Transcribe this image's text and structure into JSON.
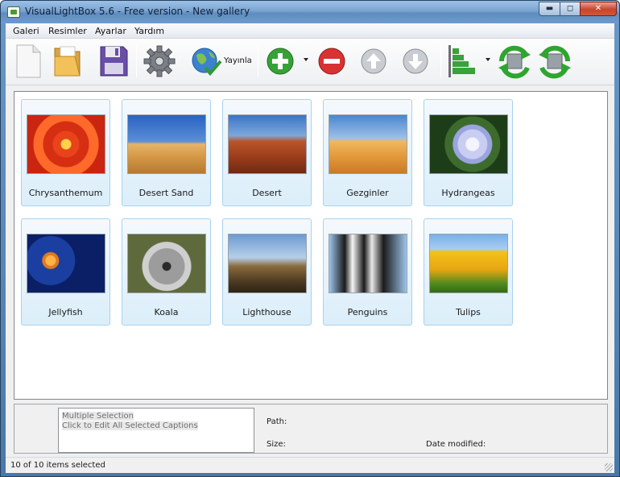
{
  "window": {
    "title": "VisualLightBox 5.6 - Free version -  New gallery"
  },
  "menu": [
    "Galeri",
    "Resimler",
    "Ayarlar",
    "Yardım"
  ],
  "toolbar": {
    "publish_label": "Yayınla",
    "icons": [
      "new-file-icon",
      "open-folder-icon",
      "save-disk-icon",
      "settings-gear-icon",
      "publish-globe-icon",
      "add-icon",
      "remove-icon",
      "move-up-icon",
      "move-down-icon",
      "sort-icon",
      "rotate-left-icon",
      "rotate-right-icon"
    ]
  },
  "gallery": {
    "items": [
      {
        "caption": "Chrysanthemum"
      },
      {
        "caption": "Desert Sand"
      },
      {
        "caption": "Desert"
      },
      {
        "caption": "Gezginler"
      },
      {
        "caption": "Hydrangeas"
      },
      {
        "caption": "Jellyfish"
      },
      {
        "caption": "Koala"
      },
      {
        "caption": "Lighthouse"
      },
      {
        "caption": "Penguins"
      },
      {
        "caption": "Tulips"
      }
    ]
  },
  "details": {
    "caption_line1": "Multiple Selection",
    "caption_line2": "Click to Edit All Selected Captions",
    "path_label": "Path:",
    "size_label": "Size:",
    "date_label": "Date modified:"
  },
  "status": {
    "text": "10 of 10 items selected"
  },
  "colors": {
    "accent": "#7aa4d0",
    "card_border": "#a9d2ee",
    "add": "#2e9a2e",
    "remove": "#d22a2a"
  }
}
